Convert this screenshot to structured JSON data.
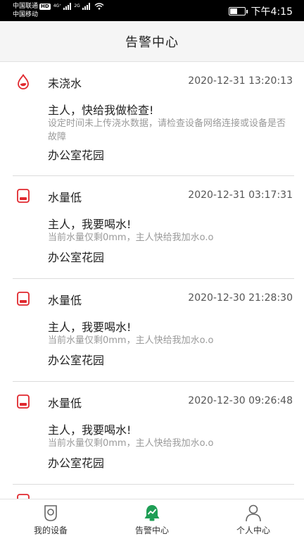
{
  "status_bar": {
    "carrier1": "中国联通",
    "hd_badge": "HD",
    "net1": "4G⁺",
    "net2": "2G",
    "carrier2": "中国移动",
    "time": "下午4:15"
  },
  "header": {
    "title": "告警中心"
  },
  "alarms": [
    {
      "type": "未浇水",
      "icon": "water-drop-icon",
      "time": "2020-12-31 13:20:13",
      "title": "主人，快给我做检查!",
      "desc": "设定时间未上传浇水数据，请检查设备网络连接或设备是否故障",
      "location": "办公室花园"
    },
    {
      "type": "水量低",
      "icon": "low-water-cup-icon",
      "time": "2020-12-31 03:17:31",
      "title": "主人，我要喝水!",
      "desc": "当前水量仅剩0mm，主人快给我加水o.o",
      "location": "办公室花园"
    },
    {
      "type": "水量低",
      "icon": "low-water-cup-icon",
      "time": "2020-12-30 21:28:30",
      "title": "主人，我要喝水!",
      "desc": "当前水量仅剩0mm，主人快给我加水o.o",
      "location": "办公室花园"
    },
    {
      "type": "水量低",
      "icon": "low-water-cup-icon",
      "time": "2020-12-30 09:26:48",
      "title": "主人，我要喝水!",
      "desc": "当前水量仅剩0mm，主人快给我加水o.o",
      "location": "办公室花园"
    }
  ],
  "bottom_nav": {
    "items": [
      {
        "label": "我的设备",
        "icon": "device-icon",
        "active": false
      },
      {
        "label": "告警中心",
        "icon": "alarm-bell-icon",
        "active": true
      },
      {
        "label": "个人中心",
        "icon": "person-icon",
        "active": false
      }
    ]
  },
  "colors": {
    "alert_red": "#e0282e",
    "active_green": "#1e9e55",
    "header_bg": "#f5f5f5"
  }
}
